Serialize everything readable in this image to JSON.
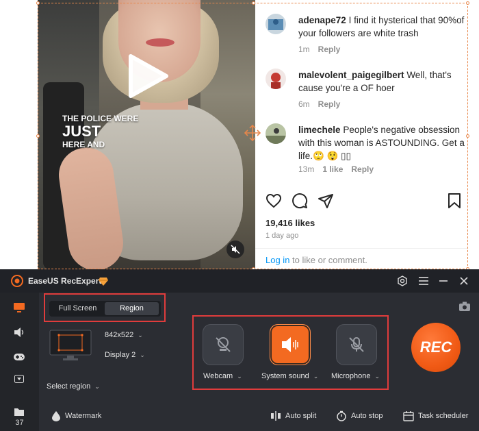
{
  "instagram": {
    "video": {
      "caption_line1": "THE POLICE WERE",
      "caption_line2": "JUST",
      "caption_line3": "HERE AND"
    },
    "comments": [
      {
        "user": "adenape72",
        "text": "I find it hysterical that 90%of your followers are white trash",
        "time": "1m",
        "actions": [
          "Reply"
        ]
      },
      {
        "user": "malevolent_paigegilbert",
        "text": "Well, that's cause you're a OF hoer",
        "time": "6m",
        "actions": [
          "Reply"
        ]
      },
      {
        "user": "limechele",
        "text": "People's negative obsession with this woman is ASTOUNDING. Get a life.🙄 😲 ▯▯",
        "time": "13m",
        "actions": [
          "1 like",
          "Reply"
        ]
      }
    ],
    "likes": "19,416 likes",
    "posted": "1 day ago",
    "login_link": "Log in",
    "login_suffix": " to like or comment."
  },
  "recorder": {
    "app_title": "EaseUS RecExperts",
    "tabs": {
      "full_screen": "Full Screen",
      "region": "Region"
    },
    "resolution": "842x522",
    "display": "Display 2",
    "select_region": "Select region",
    "devices": [
      {
        "label": "Webcam",
        "icon": "webcam-off-icon",
        "active": false
      },
      {
        "label": "System sound",
        "icon": "speaker-icon",
        "active": true
      },
      {
        "label": "Microphone",
        "icon": "microphone-off-icon",
        "active": false
      }
    ],
    "rec_label": "REC",
    "rail_count": "37",
    "bottom": {
      "watermark": "Watermark",
      "auto_split": "Auto split",
      "auto_stop": "Auto stop",
      "task_scheduler": "Task scheduler"
    },
    "colors": {
      "accent": "#f36a21",
      "highlight_box": "#e03c3c",
      "panel_bg": "#2b2d33"
    }
  }
}
